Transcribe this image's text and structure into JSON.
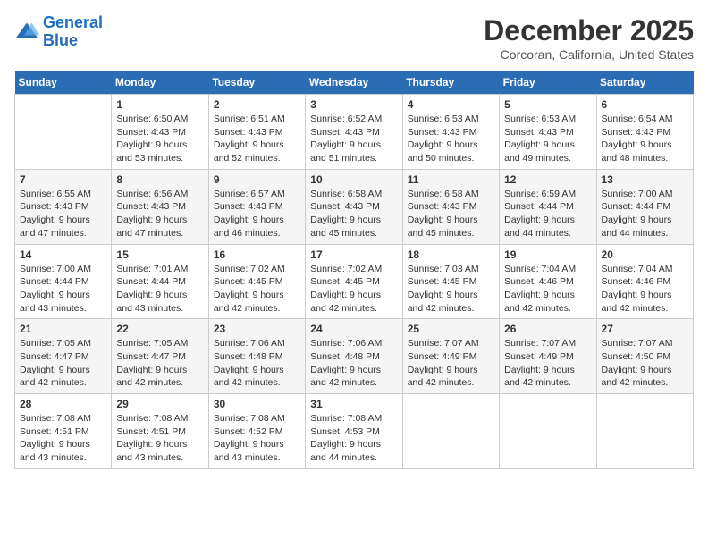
{
  "logo": {
    "line1": "General",
    "line2": "Blue"
  },
  "title": "December 2025",
  "subtitle": "Corcoran, California, United States",
  "weekdays": [
    "Sunday",
    "Monday",
    "Tuesday",
    "Wednesday",
    "Thursday",
    "Friday",
    "Saturday"
  ],
  "weeks": [
    [
      {
        "day": "",
        "info": ""
      },
      {
        "day": "1",
        "info": "Sunrise: 6:50 AM\nSunset: 4:43 PM\nDaylight: 9 hours\nand 53 minutes."
      },
      {
        "day": "2",
        "info": "Sunrise: 6:51 AM\nSunset: 4:43 PM\nDaylight: 9 hours\nand 52 minutes."
      },
      {
        "day": "3",
        "info": "Sunrise: 6:52 AM\nSunset: 4:43 PM\nDaylight: 9 hours\nand 51 minutes."
      },
      {
        "day": "4",
        "info": "Sunrise: 6:53 AM\nSunset: 4:43 PM\nDaylight: 9 hours\nand 50 minutes."
      },
      {
        "day": "5",
        "info": "Sunrise: 6:53 AM\nSunset: 4:43 PM\nDaylight: 9 hours\nand 49 minutes."
      },
      {
        "day": "6",
        "info": "Sunrise: 6:54 AM\nSunset: 4:43 PM\nDaylight: 9 hours\nand 48 minutes."
      }
    ],
    [
      {
        "day": "7",
        "info": "Sunrise: 6:55 AM\nSunset: 4:43 PM\nDaylight: 9 hours\nand 47 minutes."
      },
      {
        "day": "8",
        "info": "Sunrise: 6:56 AM\nSunset: 4:43 PM\nDaylight: 9 hours\nand 47 minutes."
      },
      {
        "day": "9",
        "info": "Sunrise: 6:57 AM\nSunset: 4:43 PM\nDaylight: 9 hours\nand 46 minutes."
      },
      {
        "day": "10",
        "info": "Sunrise: 6:58 AM\nSunset: 4:43 PM\nDaylight: 9 hours\nand 45 minutes."
      },
      {
        "day": "11",
        "info": "Sunrise: 6:58 AM\nSunset: 4:43 PM\nDaylight: 9 hours\nand 45 minutes."
      },
      {
        "day": "12",
        "info": "Sunrise: 6:59 AM\nSunset: 4:44 PM\nDaylight: 9 hours\nand 44 minutes."
      },
      {
        "day": "13",
        "info": "Sunrise: 7:00 AM\nSunset: 4:44 PM\nDaylight: 9 hours\nand 44 minutes."
      }
    ],
    [
      {
        "day": "14",
        "info": "Sunrise: 7:00 AM\nSunset: 4:44 PM\nDaylight: 9 hours\nand 43 minutes."
      },
      {
        "day": "15",
        "info": "Sunrise: 7:01 AM\nSunset: 4:44 PM\nDaylight: 9 hours\nand 43 minutes."
      },
      {
        "day": "16",
        "info": "Sunrise: 7:02 AM\nSunset: 4:45 PM\nDaylight: 9 hours\nand 42 minutes."
      },
      {
        "day": "17",
        "info": "Sunrise: 7:02 AM\nSunset: 4:45 PM\nDaylight: 9 hours\nand 42 minutes."
      },
      {
        "day": "18",
        "info": "Sunrise: 7:03 AM\nSunset: 4:45 PM\nDaylight: 9 hours\nand 42 minutes."
      },
      {
        "day": "19",
        "info": "Sunrise: 7:04 AM\nSunset: 4:46 PM\nDaylight: 9 hours\nand 42 minutes."
      },
      {
        "day": "20",
        "info": "Sunrise: 7:04 AM\nSunset: 4:46 PM\nDaylight: 9 hours\nand 42 minutes."
      }
    ],
    [
      {
        "day": "21",
        "info": "Sunrise: 7:05 AM\nSunset: 4:47 PM\nDaylight: 9 hours\nand 42 minutes."
      },
      {
        "day": "22",
        "info": "Sunrise: 7:05 AM\nSunset: 4:47 PM\nDaylight: 9 hours\nand 42 minutes."
      },
      {
        "day": "23",
        "info": "Sunrise: 7:06 AM\nSunset: 4:48 PM\nDaylight: 9 hours\nand 42 minutes."
      },
      {
        "day": "24",
        "info": "Sunrise: 7:06 AM\nSunset: 4:48 PM\nDaylight: 9 hours\nand 42 minutes."
      },
      {
        "day": "25",
        "info": "Sunrise: 7:07 AM\nSunset: 4:49 PM\nDaylight: 9 hours\nand 42 minutes."
      },
      {
        "day": "26",
        "info": "Sunrise: 7:07 AM\nSunset: 4:49 PM\nDaylight: 9 hours\nand 42 minutes."
      },
      {
        "day": "27",
        "info": "Sunrise: 7:07 AM\nSunset: 4:50 PM\nDaylight: 9 hours\nand 42 minutes."
      }
    ],
    [
      {
        "day": "28",
        "info": "Sunrise: 7:08 AM\nSunset: 4:51 PM\nDaylight: 9 hours\nand 43 minutes."
      },
      {
        "day": "29",
        "info": "Sunrise: 7:08 AM\nSunset: 4:51 PM\nDaylight: 9 hours\nand 43 minutes."
      },
      {
        "day": "30",
        "info": "Sunrise: 7:08 AM\nSunset: 4:52 PM\nDaylight: 9 hours\nand 43 minutes."
      },
      {
        "day": "31",
        "info": "Sunrise: 7:08 AM\nSunset: 4:53 PM\nDaylight: 9 hours\nand 44 minutes."
      },
      {
        "day": "",
        "info": ""
      },
      {
        "day": "",
        "info": ""
      },
      {
        "day": "",
        "info": ""
      }
    ]
  ]
}
